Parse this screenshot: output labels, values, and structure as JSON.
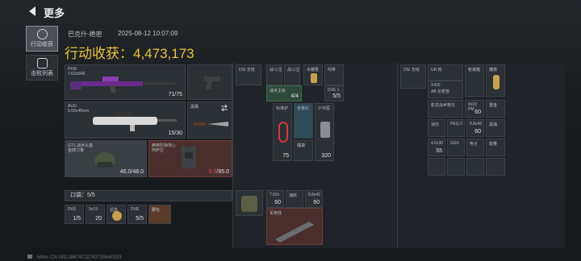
{
  "header": {
    "title": "更多"
  },
  "tabs": [
    {
      "label": "行动收获"
    },
    {
      "label": "击败列表"
    }
  ],
  "raid": {
    "player": "巴克什-绝密",
    "time": "2025-08-12 10:07:09",
    "gain_label": "行动收获：",
    "gain_value": "4,473,173"
  },
  "weapons": {
    "primary": {
      "name": "PKM",
      "sub": "7.62x54R",
      "ammo": "71/75"
    },
    "secondary": {
      "name": "AUG",
      "sub": "5.56x45mm",
      "ammo": "15/30"
    },
    "melee": {
      "name": "黑鹰"
    },
    "helmet": {
      "name": "GT1 战术头盔",
      "sub": "金牌力量",
      "durability": "46.0/48.0"
    },
    "armor": {
      "name": "精英防弹背心",
      "sub": "阿萨拉",
      "durability_cur": "0.0",
      "durability_max": "/95.0"
    }
  },
  "pocket": {
    "label": "口袋：5/5",
    "items": [
      {
        "name": "DVE",
        "count": "1/5"
      },
      {
        "name": "9x19",
        "count": "20"
      },
      {
        "name": "滤盒",
        "count": ""
      },
      {
        "name": "DVE",
        "count": "5/5"
      },
      {
        "name": "腰包",
        "count": ""
      }
    ]
  },
  "chest": {
    "items": [
      {
        "name": "DSI 无线",
        "count": ""
      },
      {
        "name": "战斗注",
        "count": ""
      },
      {
        "name": "战斗注",
        "count": ""
      },
      {
        "name": "木雕香",
        "count": ""
      },
      {
        "name": "吗啡",
        "count": ""
      },
      {
        "name": "战术主板",
        "count": "4/4"
      },
      {
        "name": "DVE 1",
        "count": "5/5"
      },
      {
        "name": "标准护",
        "count": ""
      },
      {
        "name": "全景红",
        "count": ""
      },
      {
        "name": "户外医",
        "count": ""
      },
      {
        "name": "睡袋",
        "count": ""
      },
      {
        "name": "75",
        "count": "75"
      },
      {
        "name": "320",
        "count": "320"
      }
    ]
  },
  "bag_items": [
    {
      "name": "7.62x",
      "count": "60"
    },
    {
      "name": "海妖",
      "count": ""
    },
    {
      "name": "5.8x42",
      "count": "60"
    },
    {
      "name": "军用挂",
      "count": ""
    }
  ],
  "backpack": {
    "items": [
      {
        "name": "DSI 无线",
        "count": ""
      },
      {
        "name": "UR 枪",
        "count": ""
      },
      {
        "name": "枪械箱",
        "count": ""
      },
      {
        "name": "雕像",
        "count": ""
      },
      {
        "name": "X416",
        "sub": "AB 长枪管",
        "count": ""
      },
      {
        "name": "影息战术枪托",
        "count": ""
      },
      {
        "name": "9x19",
        "sub": "PM",
        "count": "60"
      },
      {
        "name": "重金",
        "count": ""
      },
      {
        "name": "消光",
        "count": ""
      },
      {
        "name": "PEQ-2",
        "count": ""
      },
      {
        "name": "5.8x42",
        "count": "60"
      },
      {
        "name": "黑海",
        "count": ""
      },
      {
        "name": "4.6x30",
        "count": "55"
      },
      {
        "name": "GSS",
        "count": ""
      },
      {
        "name": "电子",
        "count": ""
      },
      {
        "name": "能量",
        "count": ""
      }
    ]
  },
  "footer": {
    "text": "64ms  CN UID:18674711743735640533"
  }
}
